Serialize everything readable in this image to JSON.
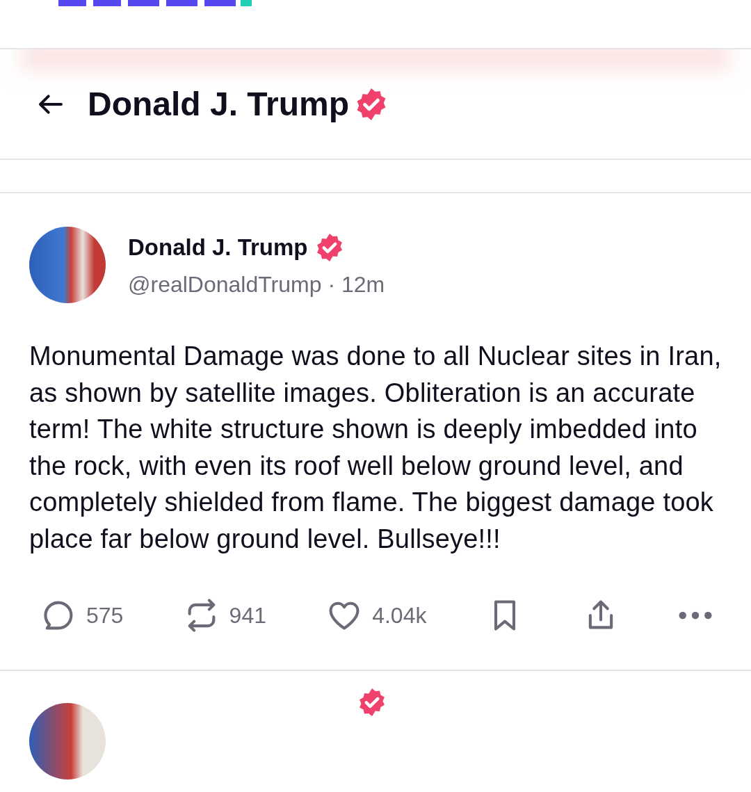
{
  "header": {
    "title": "Donald J. Trump",
    "verified": true
  },
  "post": {
    "author": "Donald J. Trump",
    "verified": true,
    "handle": "@realDonaldTrump",
    "separator": "·",
    "time": "12m",
    "body": "Monumental Damage was done to all Nuclear sites in Iran, as shown by satellite images. Obliteration is an accurate term! The white structure shown is deeply imbedded into the rock, with even its roof well below ground level, and completely shielded from flame. The biggest damage took place far below ground level. Bullseye!!!",
    "actions": [
      {
        "kind": "reply",
        "count": "575"
      },
      {
        "kind": "repost",
        "count": "941"
      },
      {
        "kind": "like",
        "count": "4.04k"
      },
      {
        "kind": "bookmark"
      },
      {
        "kind": "share"
      },
      {
        "kind": "more"
      }
    ]
  },
  "next_post": {
    "verified": true
  }
}
